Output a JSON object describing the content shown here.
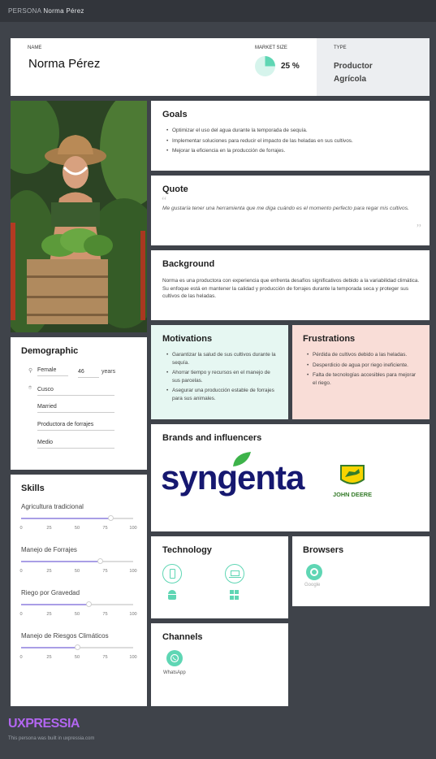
{
  "topbar": {
    "label": "PERSONA",
    "name": "Norma Pérez"
  },
  "header": {
    "name_label": "NAME",
    "name": "Norma Pérez",
    "market_label": "MARKET SIZE",
    "market_value": "25 %",
    "market_fraction": 0.25,
    "type_label": "TYPE",
    "type_value_line1": "Productor",
    "type_value_line2": "Agrícola"
  },
  "goals": {
    "title": "Goals",
    "items": [
      "Optimizar el uso del agua durante la temporada de sequía.",
      "Implementar soluciones para reducir el impacto de las heladas en sus cultivos.",
      "Mejorar la eficiencia en la producción de forrajes."
    ]
  },
  "quote": {
    "title": "Quote",
    "text": "Me gustaría tener una herramienta que me diga cuándo es el momento perfecto para regar mis cultivos."
  },
  "background": {
    "title": "Background",
    "text": "Norma es una productora con experiencia que enfrenta desafíos significativos debido a la variabilidad climática. Su enfoque está en mantener la calidad y producción de forrajes durante la temporada seca y proteger sus cultivos de las heladas."
  },
  "demographic": {
    "title": "Demographic",
    "gender": "Female",
    "age": "46",
    "age_unit": "years",
    "location": "Cusco",
    "status": "Married",
    "occupation": "Productora de forrajes",
    "income": "Medio"
  },
  "motivations": {
    "title": "Motivations",
    "items": [
      "Garantizar la salud de sus cultivos durante la sequía.",
      "Ahorrar tiempo y recursos en el manejo de sus parcelas.",
      "Asegurar una producción estable de forrajes para sus animales."
    ]
  },
  "frustrations": {
    "title": "Frustrations",
    "items": [
      "Pérdida de cultivos debido a las heladas.",
      "Desperdicio de agua por riego ineficiente.",
      "Falta de tecnologías accesibles para mejorar el riego."
    ]
  },
  "brands": {
    "title": "Brands and influencers",
    "brand1": "syngenta",
    "brand2": "JOHN DEERE"
  },
  "skills": {
    "title": "Skills",
    "ticks": [
      "0",
      "25",
      "50",
      "75",
      "100"
    ],
    "items": [
      {
        "label": "Agricultura tradicional",
        "value": 80
      },
      {
        "label": "Manejo de Forrajes",
        "value": 70
      },
      {
        "label": "Riego por Gravedad",
        "value": 60
      },
      {
        "label": "Manejo de Riesgos Climáticos",
        "value": 50
      }
    ]
  },
  "technology": {
    "title": "Technology",
    "icons": [
      "mobile-icon",
      "laptop-icon",
      "android-icon",
      "windows-icon"
    ]
  },
  "browsers": {
    "title": "Browsers",
    "item": "Google"
  },
  "channels": {
    "title": "Channels",
    "item": "WhatsApp"
  },
  "footer": {
    "brand": "UXPRESSIA",
    "note": "This persona was built in uxpressia.com"
  },
  "colors": {
    "accent_mint": "#5fd6b4",
    "motivations_bg": "#e6f7f2",
    "frustrations_bg": "#f9ddd7",
    "slider_fill": "#a99ee6",
    "brand_purple": "#b266f0"
  }
}
